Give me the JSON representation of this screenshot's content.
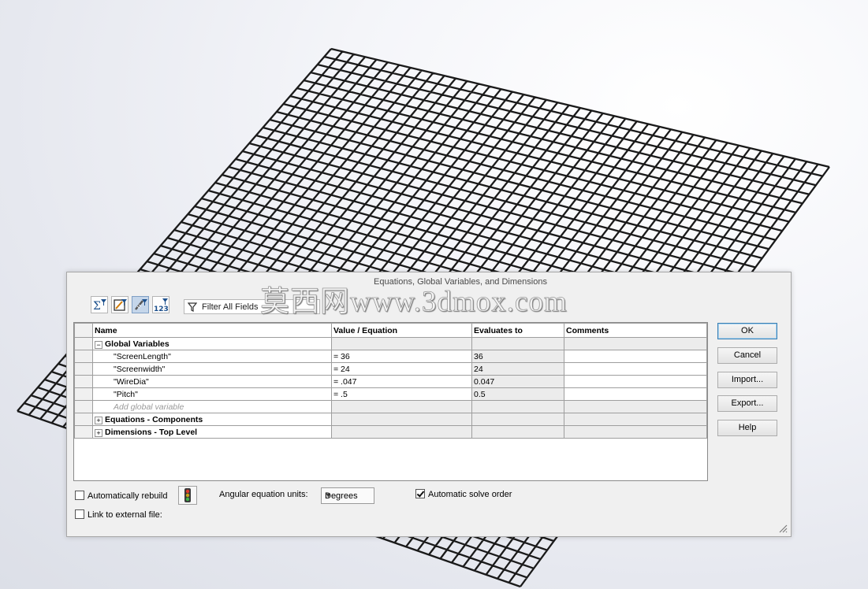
{
  "dialog": {
    "title": "Equations, Global Variables, and Dimensions",
    "filter_placeholder": "Filter All Fields",
    "toolbar": [
      {
        "icon": "equation-view-icon",
        "pressed": false
      },
      {
        "icon": "sketch-equation-view-icon",
        "pressed": false
      },
      {
        "icon": "dimension-view-icon",
        "pressed": true
      },
      {
        "icon": "ordered-view-icon",
        "pressed": false
      }
    ],
    "table": {
      "headers": {
        "name": "Name",
        "value": "Value / Equation",
        "evaluates": "Evaluates to",
        "comments": "Comments"
      },
      "group_global": "Global Variables",
      "rows": [
        {
          "name": "\"ScreenLength\"",
          "value": "= 36",
          "evaluates": "36",
          "comments": ""
        },
        {
          "name": "\"Screenwidth\"",
          "value": "= 24",
          "evaluates": "24",
          "comments": ""
        },
        {
          "name": "\"WireDia\"",
          "value": "= .047",
          "evaluates": "0.047",
          "comments": ""
        },
        {
          "name": "\"Pitch\"",
          "value": "= .5",
          "evaluates": "0.5",
          "comments": ""
        }
      ],
      "add_placeholder": "Add global variable",
      "group_equations": "Equations - Components",
      "group_dimensions": "Dimensions - Top Level"
    },
    "buttons": {
      "ok": "OK",
      "cancel": "Cancel",
      "import": "Import...",
      "export": "Export...",
      "help": "Help"
    },
    "options": {
      "auto_rebuild": "Automatically rebuild",
      "auto_rebuild_checked": false,
      "link_external": "Link to external file:",
      "link_external_checked": false,
      "angular_units_label": "Angular equation units:",
      "angular_units_value": "Degrees",
      "auto_solve": "Automatic solve order",
      "auto_solve_checked": true
    }
  },
  "watermark": "莫西网www.3dmox.com"
}
